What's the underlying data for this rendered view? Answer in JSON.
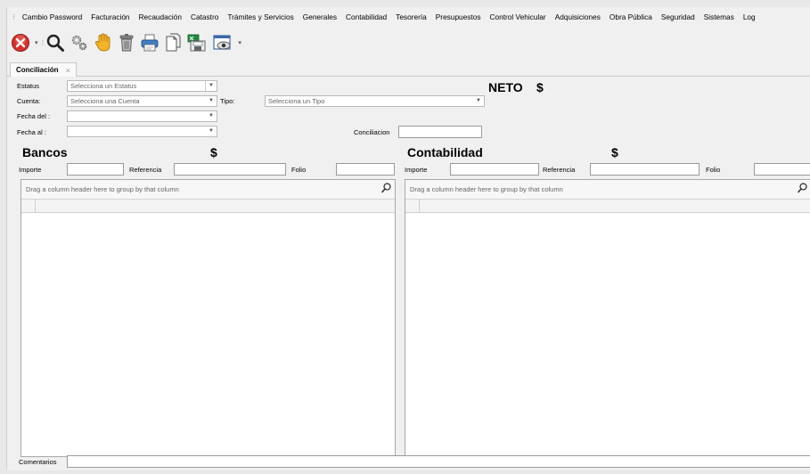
{
  "menu": {
    "grip": "⁝",
    "items": [
      "Cambio Password",
      "Facturación",
      "Recaudación",
      "Catastro",
      "Trámites y Servicios",
      "Generales",
      "Contabilidad",
      "Tesorería",
      "Presupuestos",
      "Control Vehicular",
      "Adquisiciones",
      "Obra Pública",
      "Seguridad",
      "Sistemas",
      "Log"
    ]
  },
  "toolbar": {
    "icons": [
      "close-icon",
      "search-icon",
      "gears-icon",
      "hand-icon",
      "trash-icon",
      "printer-icon",
      "copy-icon",
      "excel-export-icon",
      "preview-icon"
    ]
  },
  "tab": {
    "label": "Conciliación",
    "close": "×"
  },
  "form": {
    "estatus_label": "Estatus",
    "estatus_value": "Selecciona un Estatus",
    "cuenta_label": "Cuenta:",
    "cuenta_value": "Selecciona una Cuenta",
    "tipo_label": "Tipo:",
    "tipo_value": "Selecciona un Tipo",
    "fecha_del_label": "Fecha del :",
    "fecha_al_label": "Fecha al :",
    "conciliacion_label": "Conciliacion",
    "neto_label": "NETO",
    "neto_currency": "$",
    "comentarios_label": "Comentarios",
    "dropdown_arrow": "▼"
  },
  "bancos": {
    "title": "Bancos",
    "currency": "$",
    "importe_label": "Importe",
    "referencia_label": "Referencia",
    "folio_label": "Folio",
    "group_hint": "Drag a column header here to group by that column"
  },
  "contabilidad": {
    "title": "Contabilidad",
    "currency": "$",
    "importe_label": "Importe",
    "referencia_label": "Referencia",
    "folio_label": "Folio",
    "group_hint": "Drag a column header here to group by that column"
  }
}
